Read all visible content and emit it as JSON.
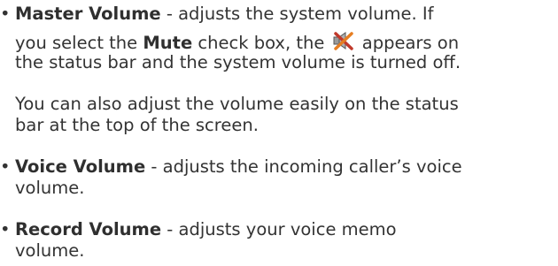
{
  "bullet_glyph": "•",
  "master": {
    "term": "Master Volume",
    "line1_rest": " - adjusts the system volume. If",
    "line2_pre": "you select the ",
    "mute_term": "Mute",
    "line2_post": " check box, the ",
    "icon": "muted-speaker-icon",
    "line2_end": " appears on",
    "line3": "the status bar and the system volume is turned off."
  },
  "note": {
    "line1": "You can also adjust the volume easily on the status",
    "line2": "bar at the top of the screen."
  },
  "voice": {
    "term": "Voice Volume",
    "line1_rest": " - adjusts the incoming caller’s voice",
    "line2": "volume."
  },
  "record": {
    "term": "Record Volume",
    "line1_rest": " - adjusts your voice memo",
    "line2": "volume."
  }
}
